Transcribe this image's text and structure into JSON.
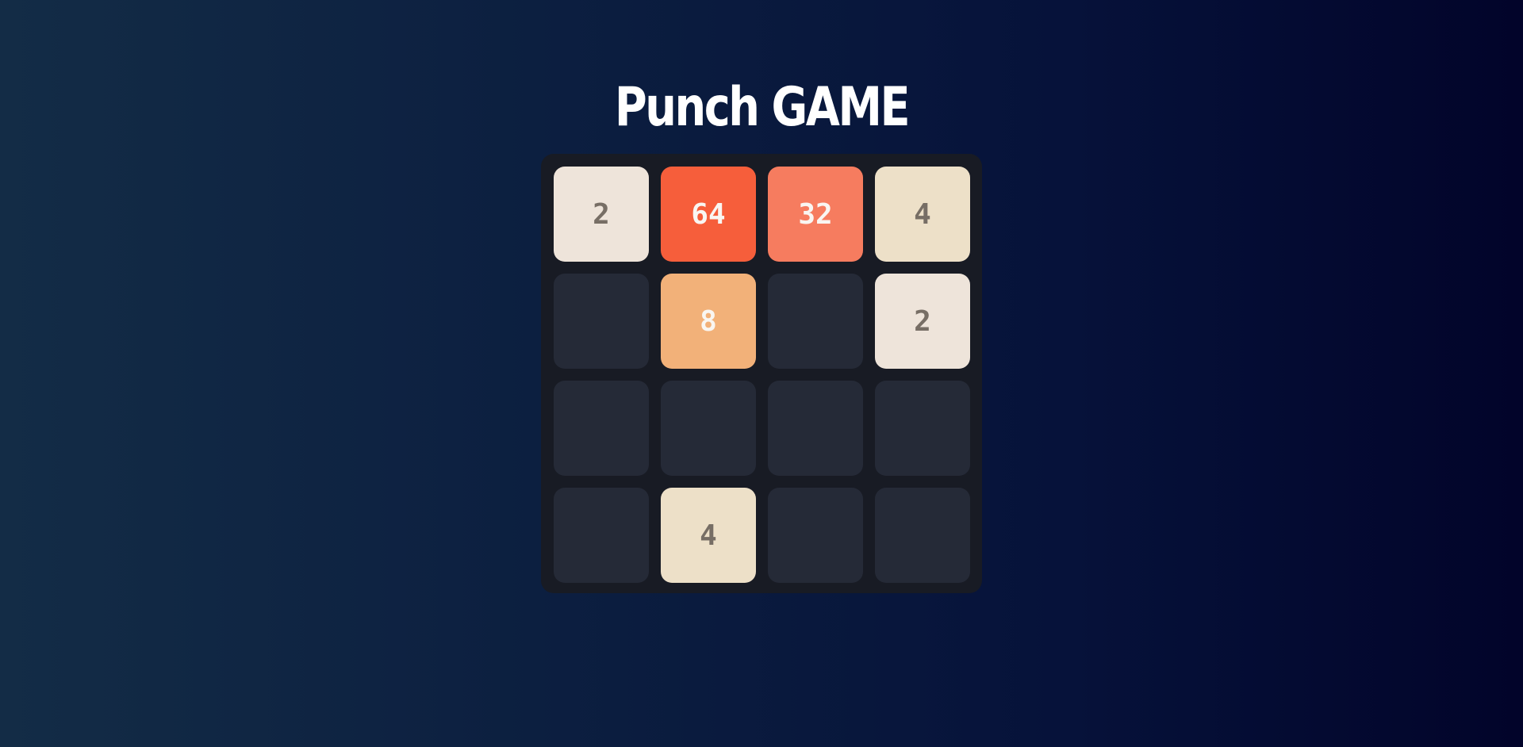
{
  "game": {
    "title": "Punch GAME",
    "board": [
      [
        "2",
        "64",
        "32",
        "4"
      ],
      [
        "",
        "8",
        "",
        "2"
      ],
      [
        "",
        "",
        "",
        ""
      ],
      [
        "",
        "4",
        "",
        ""
      ]
    ]
  },
  "colors": {
    "empty_cell": "#252a37",
    "board_bg": "#181b24",
    "tile_2": "#eee4da",
    "tile_4": "#ede0c8",
    "tile_8": "#f2b179",
    "tile_32": "#f67c5f",
    "tile_64": "#f65e3b",
    "dark_text": "#776e65",
    "light_text": "#f9f6f2"
  }
}
